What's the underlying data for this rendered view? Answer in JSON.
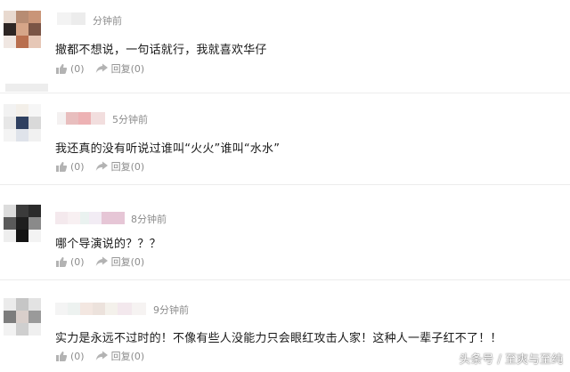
{
  "comments": [
    {
      "time": "分钟前",
      "text": "撤都不想说，一句话就行，我就喜欢华仔",
      "like_label": "(0)",
      "reply_label": "回复(0)"
    },
    {
      "time": "5分钟前",
      "text": "我还真的没有听说过谁叫“火火”谁叫“水水”",
      "like_label": "(0)",
      "reply_label": "回复(0)"
    },
    {
      "time": "8分钟前",
      "text": "哪个导演说的？？？",
      "like_label": "(0)",
      "reply_label": "回复(0)"
    },
    {
      "time": "9分钟前",
      "text": "实力是永远不过时的！不像有些人没能力只会眼红攻击人家！这种人一辈子红不了！！",
      "like_label": "(0)",
      "reply_label": "回复(0)"
    }
  ],
  "watermark": "头条号 / 至爽与至纯",
  "icons": {
    "like": "thumbs-up-icon",
    "reply": "reply-arrow-icon"
  },
  "colors": {
    "meta_text": "#8c8c8c",
    "body_text": "#1a1a1a",
    "divider": "#ececec"
  }
}
